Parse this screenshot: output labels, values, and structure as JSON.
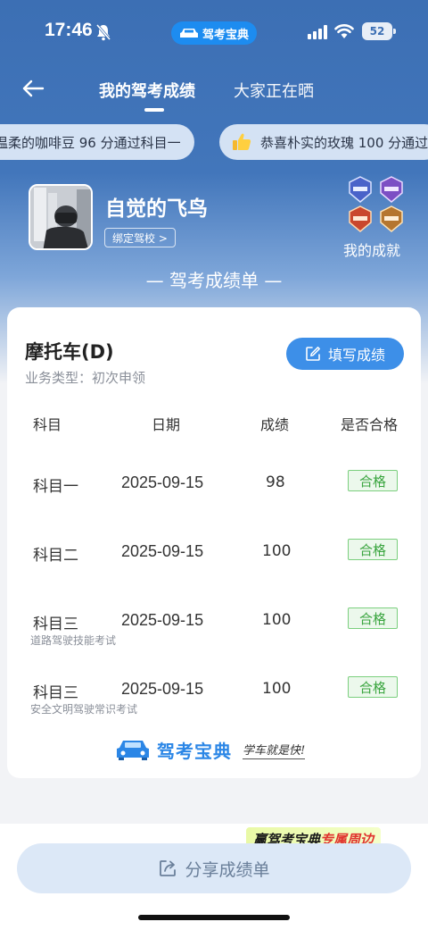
{
  "status_bar": {
    "time": "17:46",
    "app_pill": "驾考宝典",
    "battery": "52"
  },
  "nav": {
    "tabs": [
      {
        "label": "我的驾考成绩",
        "active": true
      },
      {
        "label": "大家正在晒",
        "active": false
      }
    ]
  },
  "tickers": [
    "温柔的咖啡豆 96 分通过科目一",
    "恭喜朴实的玫瑰 100 分通过"
  ],
  "profile": {
    "username": "自觉的飞鸟",
    "bind_school": "绑定驾校 >",
    "achievements_label": "我的成就"
  },
  "report_heading": "— 驾考成绩单 —",
  "card": {
    "vehicle": "摩托车(D)",
    "business_type": "业务类型：初次申领",
    "fill_button": "填写成绩",
    "headers": {
      "subject": "科目",
      "date": "日期",
      "score": "成绩",
      "pass": "是否合格"
    },
    "rows": [
      {
        "subject": "科目一",
        "date": "2025-09-15",
        "score": "98",
        "pass": "合格",
        "note": ""
      },
      {
        "subject": "科目二",
        "date": "2025-09-15",
        "score": "100",
        "pass": "合格",
        "note": ""
      },
      {
        "subject": "科目三",
        "date": "2025-09-15",
        "score": "100",
        "pass": "合格",
        "note": "道路驾驶技能考试"
      },
      {
        "subject": "科目三",
        "date": "2025-09-15",
        "score": "100",
        "pass": "合格",
        "note": "安全文明驾驶常识考试"
      }
    ],
    "brand": {
      "name": "驾考宝典",
      "slogan": "学车就是快!"
    }
  },
  "promo": {
    "prefix": "赢驾考宝典",
    "highlight": "专属周边"
  },
  "share_button": "分享成绩单",
  "colors": {
    "header_blue": "#3c6fb4",
    "accent_blue": "#3d8fe8",
    "pass_green": "#3aa53f"
  }
}
